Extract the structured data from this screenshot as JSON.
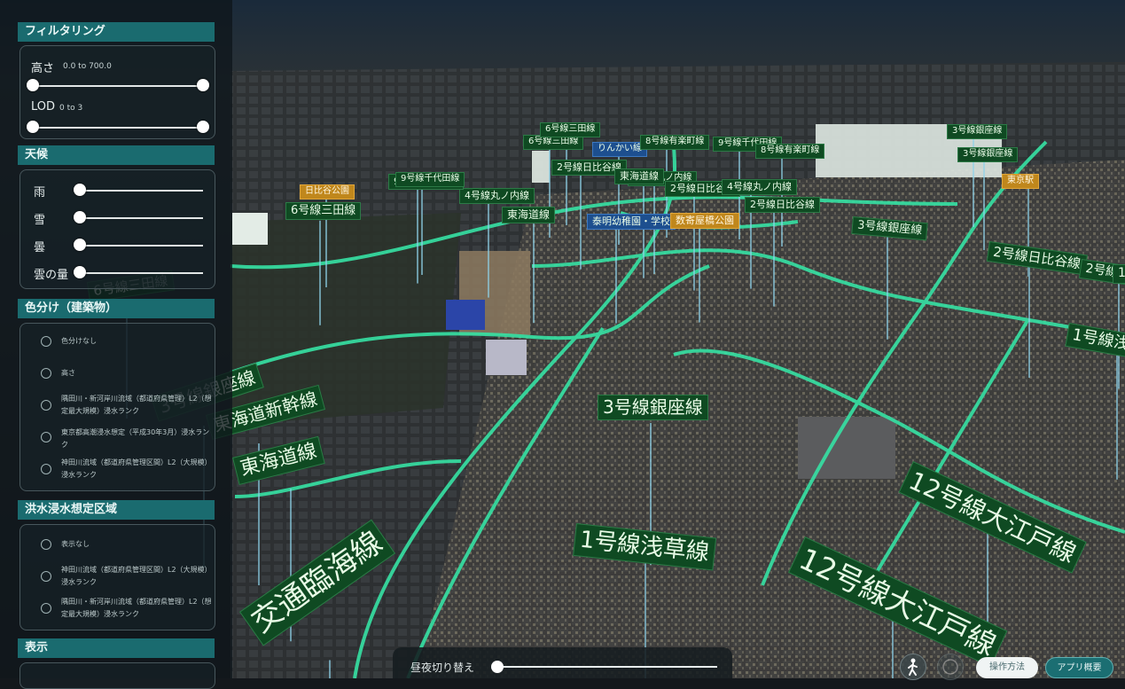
{
  "panel": {
    "filtering": {
      "title": "フィルタリング",
      "height_label": "高さ",
      "height_range": "0.0 to 700.0",
      "lod_label": "LOD",
      "lod_range": "0 to 3"
    },
    "weather": {
      "title": "天候",
      "rain": "雨",
      "snow": "雪",
      "cloud": "曇",
      "cloud_amount": "雲の量"
    },
    "coloring": {
      "title": "色分け（建築物）",
      "options": [
        "色分けなし",
        "高さ",
        "隅田川・新河岸川流域（都道府県管理）L2（想定最大規模）浸水ランク",
        "東京都高潮浸水想定（平成30年3月）浸水ランク",
        "神田川流域（都道府県管理区間）L2（大規模）浸水ランク"
      ]
    },
    "flood": {
      "title": "洪水浸水想定区域",
      "options": [
        "表示なし",
        "神田川流域（都道府県管理区間）L2（大規模）浸水ランク",
        "隅田川・新河岸川流域（都道府県管理）L2（想定最大規模）浸水ランク"
      ]
    },
    "display": {
      "title": "表示"
    }
  },
  "bottom": {
    "daynight_label": "昼夜切り替え",
    "daynight_level": 0.0,
    "help_button": "操作方法",
    "about_button": "アプリ概要"
  },
  "labels": [
    {
      "text": "りんかい線",
      "color": "blue"
    },
    {
      "text": "6号線三田線"
    },
    {
      "text": "2号線日比谷線"
    },
    {
      "text": "4号線丸ノ内線"
    },
    {
      "text": "日比谷公園",
      "color": "orange"
    },
    {
      "text": "6号線三田線"
    },
    {
      "text": "9号線千代田線"
    },
    {
      "text": "4号線丸ノ内線"
    },
    {
      "text": "東海道線"
    },
    {
      "text": "6号線三田線"
    },
    {
      "text": "9号線千代田線"
    },
    {
      "text": "8号線有楽町線"
    },
    {
      "text": "8号線有楽町線"
    },
    {
      "text": "2号線日比谷線"
    },
    {
      "text": "東海道線"
    },
    {
      "text": "2号線日比谷線"
    },
    {
      "text": "4号線丸ノ内線"
    },
    {
      "text": "2号線日比谷線"
    },
    {
      "text": "泰明幼稚園・学校",
      "color": "blue"
    },
    {
      "text": "数寄屋橋公園",
      "color": "orange"
    },
    {
      "text": "3号線銀座線"
    },
    {
      "text": "2号線日比谷線"
    },
    {
      "text": "3号線銀座線"
    },
    {
      "text": "3号線銀座線"
    },
    {
      "text": "3号線銀座線"
    },
    {
      "text": "東京駅",
      "color": "orange"
    },
    {
      "text": "1号線浅草線"
    },
    {
      "text": "9号線千代田線"
    },
    {
      "text": "6号線三田線"
    },
    {
      "text": "3号線銀座線"
    },
    {
      "text": "東海道新幹線"
    },
    {
      "text": "東海道線"
    },
    {
      "text": "3号線銀座線"
    },
    {
      "text": "1号線浅草線"
    },
    {
      "text": "12号線大江戸線"
    },
    {
      "text": "12号線大江戸線"
    },
    {
      "text": "交通臨海線"
    },
    {
      "text": "12"
    }
  ]
}
